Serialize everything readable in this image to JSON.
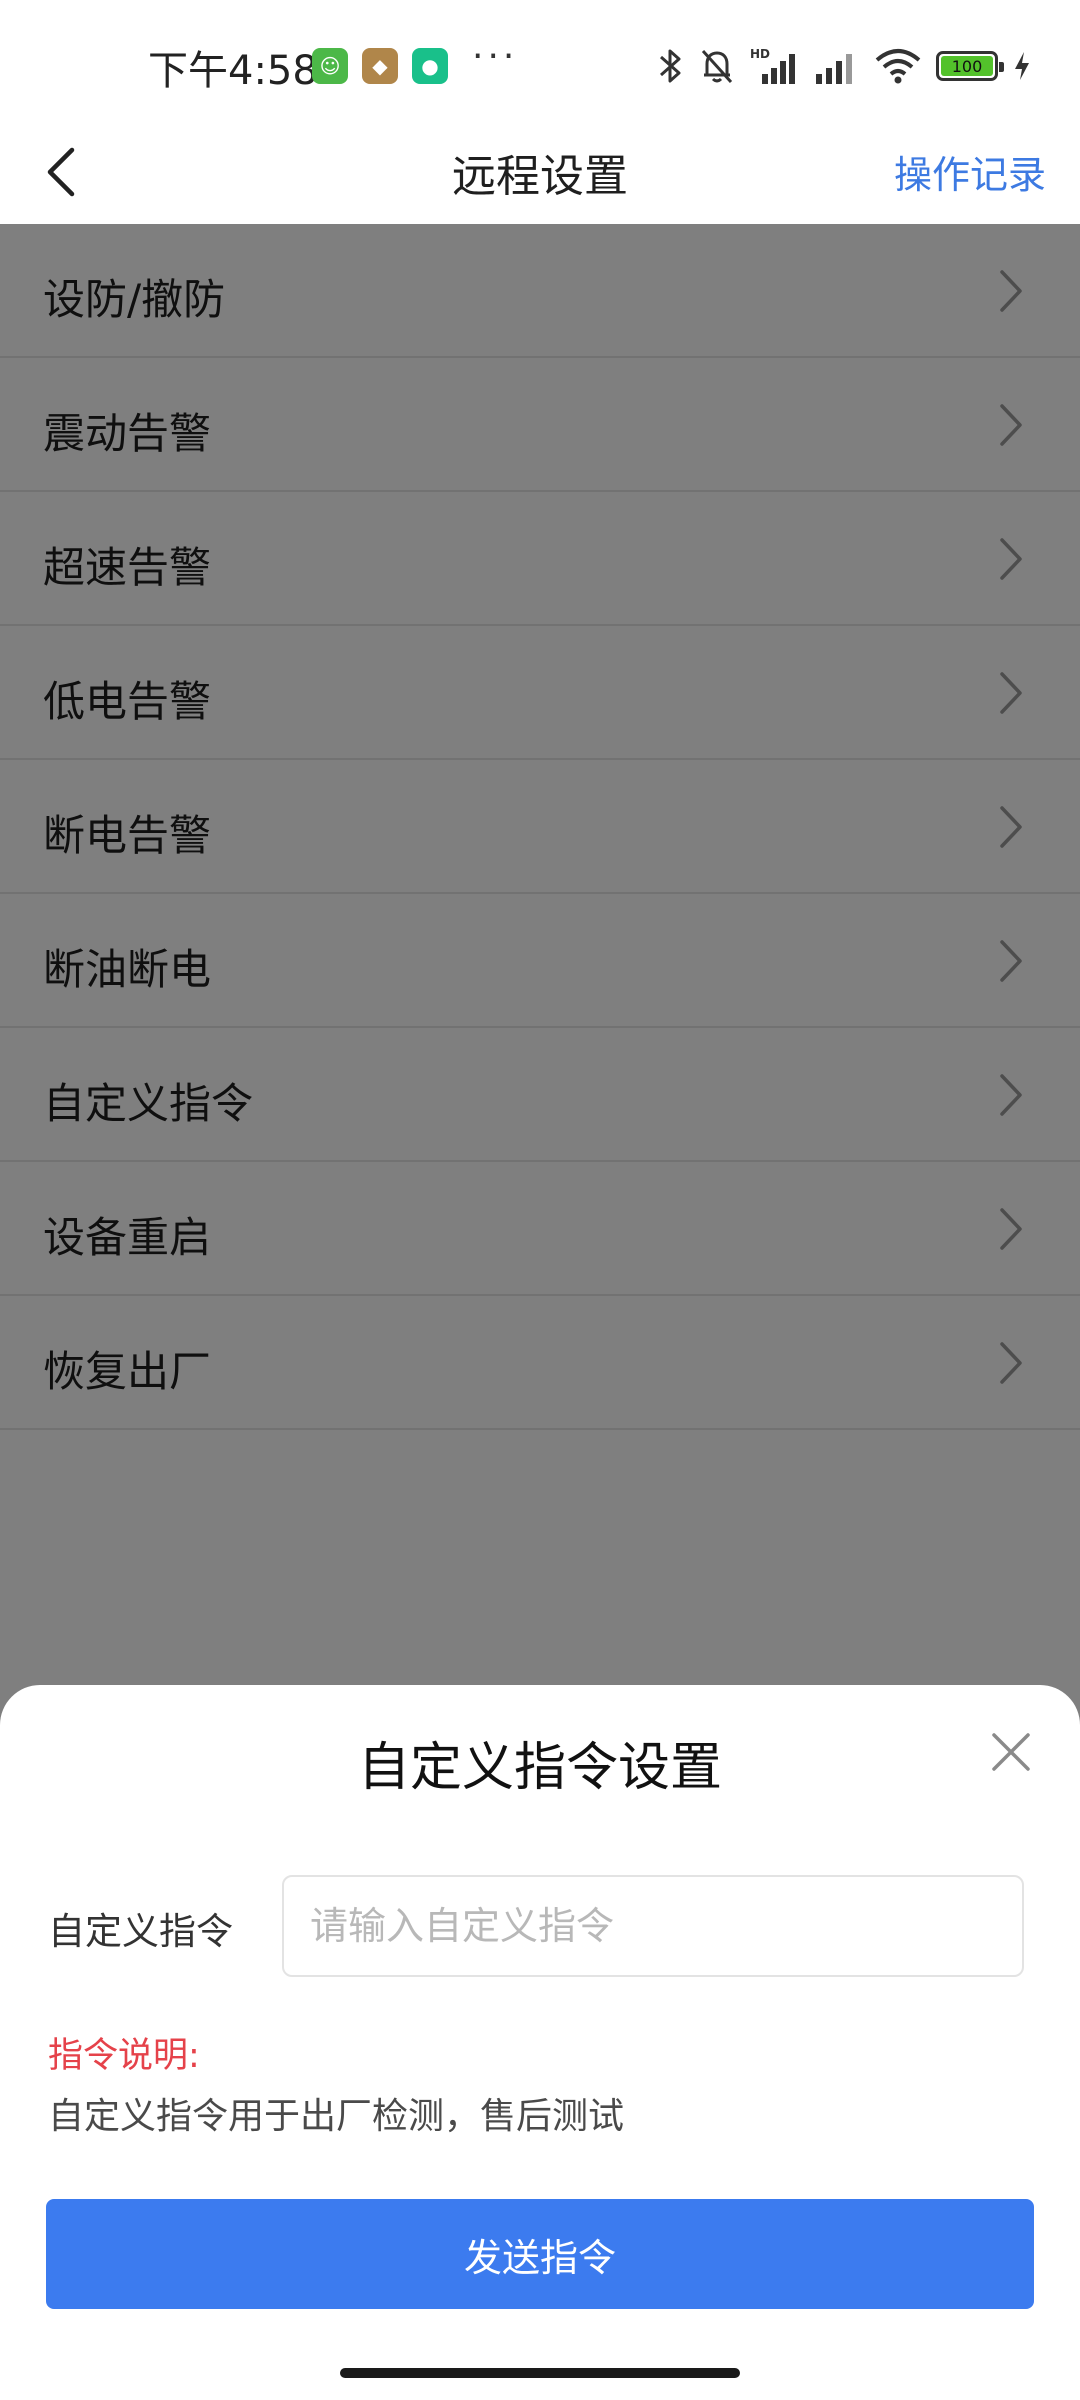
{
  "status_bar": {
    "time": "下午4:58",
    "dots": "···",
    "badges": [
      "app-green-icon",
      "app-brown-icon",
      "app-teal-icon"
    ],
    "battery_level": "100",
    "icons": [
      "bluetooth-icon",
      "mute-bell-icon",
      "cell-signal-hd-icon",
      "cell-signal-icon",
      "wifi-icon",
      "battery-icon",
      "charging-bolt-icon"
    ]
  },
  "nav": {
    "title": "远程设置",
    "action": "操作记录",
    "accent_color": "#3d7ae2"
  },
  "menu": {
    "items": [
      {
        "label": "设防/撤防"
      },
      {
        "label": "震动告警"
      },
      {
        "label": "超速告警"
      },
      {
        "label": "低电告警"
      },
      {
        "label": "断电告警"
      },
      {
        "label": "断油断电"
      },
      {
        "label": "自定义指令"
      },
      {
        "label": "设备重启"
      },
      {
        "label": "恢复出厂"
      }
    ]
  },
  "sheet": {
    "title": "自定义指令设置",
    "field_label": "自定义指令",
    "field_placeholder": "请输入自定义指令",
    "field_value": "",
    "note_title": "指令说明:",
    "note_text": "自定义指令用于出厂检测，售后测试",
    "send_label": "发送指令",
    "button_color": "#3c7bef",
    "note_color": "#e5424a"
  }
}
